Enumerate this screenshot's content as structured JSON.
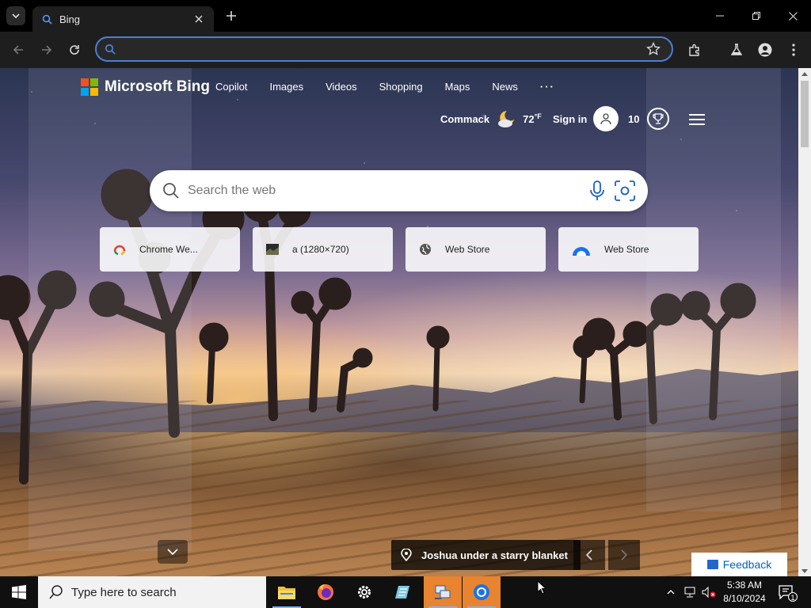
{
  "browser": {
    "tab": {
      "title": "Bing"
    },
    "omnibox": {
      "value": "",
      "placeholder": ""
    }
  },
  "bing": {
    "brand": "Microsoft Bing",
    "nav": [
      "Copilot",
      "Images",
      "Videos",
      "Shopping",
      "Maps",
      "News",
      "···"
    ],
    "weather": {
      "location": "Commack",
      "temp": "72",
      "unit": "°F"
    },
    "sign_in": "Sign in",
    "rewards_count": "10",
    "search": {
      "placeholder": "Search the web",
      "value": ""
    },
    "tiles": [
      {
        "label": "Chrome We...",
        "icon": "chrome-web-store-icon"
      },
      {
        "label": "a (1280×720)",
        "icon": "image-thumbnail-icon"
      },
      {
        "label": "Web Store",
        "icon": "globe-icon"
      },
      {
        "label": "Web Store",
        "icon": "web-store-icon"
      }
    ],
    "caption": "Joshua under a starry blanket",
    "feedback": "Feedback"
  },
  "taskbar": {
    "search_placeholder": "Type here to search",
    "apps": [
      "file-explorer-icon",
      "firefox-icon",
      "settings-icon",
      "notepad-icon",
      "network-app-icon",
      "chrome-icon"
    ],
    "clock": {
      "time": "5:38 AM",
      "date": "8/10/2024"
    },
    "notification_count": "1"
  },
  "colors": {
    "omnibox_focus": "#4a80d4",
    "feedback_text": "#0061c2",
    "taskbar": "#101010",
    "ms_red": "#f25022",
    "ms_green": "#7fba00",
    "ms_blue": "#00a4ef",
    "ms_yellow": "#ffb900"
  }
}
